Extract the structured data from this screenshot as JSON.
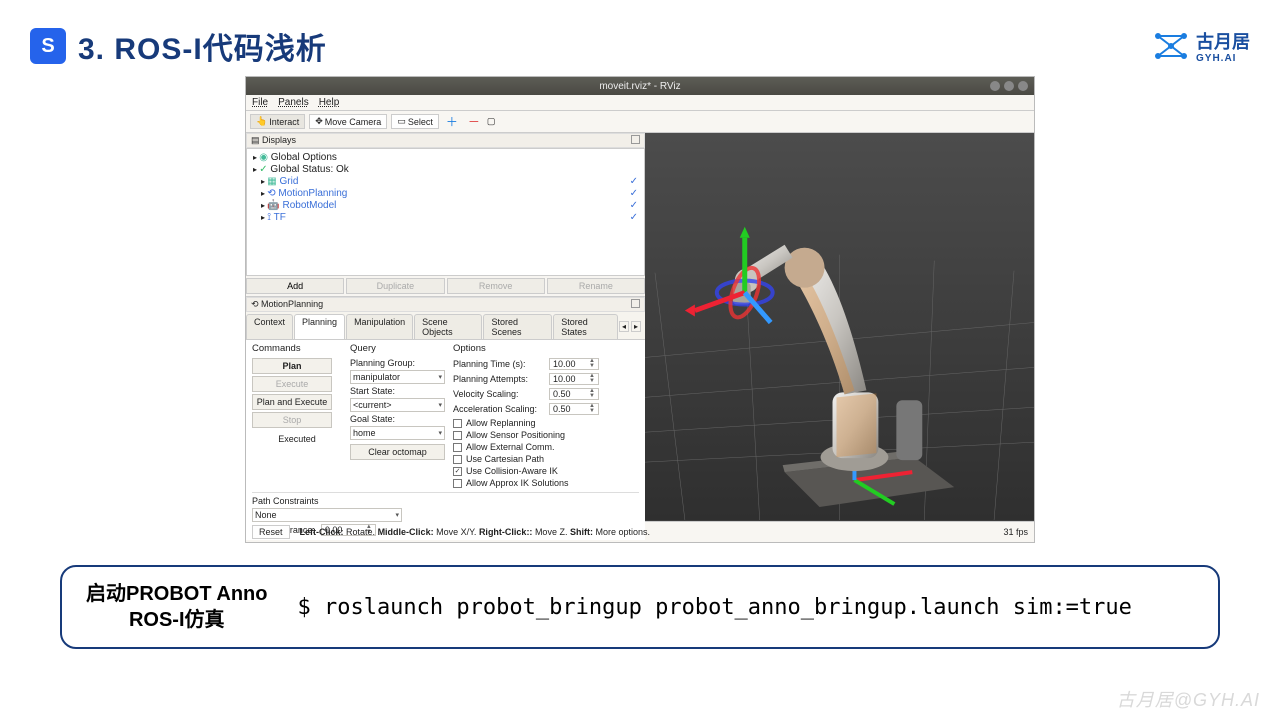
{
  "header": {
    "title": "3. ROS-I代码浅析",
    "logo_letter": "S",
    "brand": "古月居",
    "brand_sub": "GYH.AI"
  },
  "rviz": {
    "title": "moveit.rviz* - RViz",
    "menu": {
      "file": "File",
      "panels": "Panels",
      "help": "Help"
    },
    "toolbar": {
      "interact": "Interact",
      "move_camera": "Move Camera",
      "select": "Select"
    },
    "displays": {
      "header": "Displays",
      "global_options": "Global Options",
      "global_status": "Global Status: Ok",
      "grid": "Grid",
      "motion_planning": "MotionPlanning",
      "robot_model": "RobotModel",
      "tf": "TF",
      "check": "✓"
    },
    "display_btns": {
      "add": "Add",
      "duplicate": "Duplicate",
      "remove": "Remove",
      "rename": "Rename"
    },
    "mp_header": "MotionPlanning",
    "tabs": {
      "context": "Context",
      "planning": "Planning",
      "manipulation": "Manipulation",
      "scene_objects": "Scene Objects",
      "stored_scenes": "Stored Scenes",
      "stored_states": "Stored States"
    },
    "commands": {
      "header": "Commands",
      "plan": "Plan",
      "execute": "Execute",
      "plan_and_execute": "Plan and Execute",
      "stop": "Stop",
      "executed": "Executed"
    },
    "query": {
      "header": "Query",
      "planning_group": "Planning Group:",
      "planning_group_v": "manipulator",
      "start_state": "Start State:",
      "start_state_v": "<current>",
      "goal_state": "Goal State:",
      "goal_state_v": "home",
      "clear_octomap": "Clear octomap"
    },
    "options": {
      "header": "Options",
      "planning_time": "Planning Time (s):",
      "planning_time_v": "10.00",
      "planning_attempts": "Planning Attempts:",
      "planning_attempts_v": "10.00",
      "velocity_scaling": "Velocity Scaling:",
      "velocity_scaling_v": "0.50",
      "accel_scaling": "Acceleration Scaling:",
      "accel_scaling_v": "0.50",
      "allow_replanning": "Allow Replanning",
      "allow_sensor": "Allow Sensor Positioning",
      "allow_external": "Allow External Comm.",
      "use_cartesian": "Use Cartesian Path",
      "use_collision": "Use Collision-Aware IK",
      "allow_approx": "Allow Approx IK Solutions"
    },
    "path_constraints": {
      "header": "Path Constraints",
      "value": "None",
      "goal_tolerance": "Goal Tolerance:",
      "goal_tolerance_v": "0.00"
    },
    "statusbar": {
      "reset": "Reset",
      "hint": "Left-Click: Rotate. Middle-Click: Move X/Y. Right-Click:: Move Z. Shift: More options.",
      "fps": "31 fps"
    }
  },
  "bottom": {
    "left_l1": "启动PROBOT Anno",
    "left_l2": "ROS-I仿真",
    "cmd": "$ roslaunch probot_bringup probot_anno_bringup.launch sim:=true"
  },
  "watermark": "古月居@GYH.AI"
}
